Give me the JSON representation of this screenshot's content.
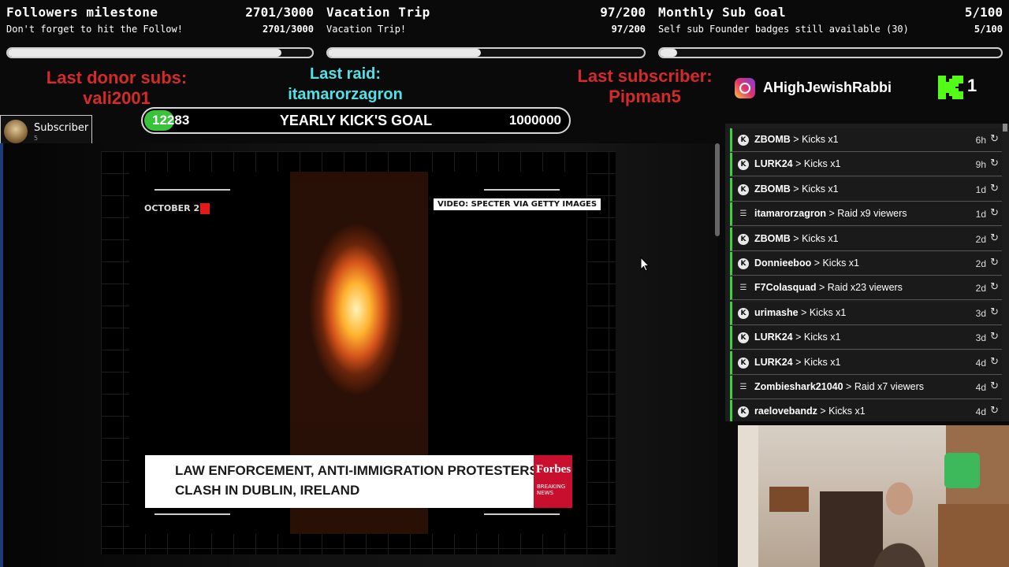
{
  "goals": [
    {
      "title": "Followers milestone",
      "count": "2701/3000",
      "subtitle": "Don't forget to hit the Follow!",
      "count_small": "2701/3000",
      "progress": 0.9
    },
    {
      "title": "Vacation Trip",
      "count": "97/200",
      "subtitle": "Vacation Trip!",
      "count_small": "97/200",
      "progress": 0.485
    },
    {
      "title": "Monthly Sub Goal",
      "count": "5/100",
      "subtitle": "Self sub Founder badges still available (30)",
      "count_small": "5/100",
      "progress": 0.05
    }
  ],
  "last_donor": {
    "label": "Last donor subs:",
    "name": "vali2001"
  },
  "last_raid": {
    "label": "Last raid:",
    "name": "itamarorzagron"
  },
  "last_subscriber": {
    "label": "Last subscriber:",
    "name": "Pipman5"
  },
  "yearly_goal": {
    "current": "12283",
    "label": "YEARLY KICK'S GOAL",
    "target": "1000000"
  },
  "subscriber_badge": {
    "label": "Subscriber",
    "count": "5"
  },
  "instagram": {
    "handle": "AHighJewishRabbi"
  },
  "kick": {
    "count": "1"
  },
  "news": {
    "rec_text": "OCTOBER 2",
    "credit": "VIDEO: SPECTER VIA GETTY IMAGES",
    "headline_1": "LAW ENFORCEMENT, ANTI-IMMIGRATION PROTESTERS",
    "headline_2": "CLASH IN DUBLIN, IRELAND",
    "brand": "Forbes",
    "brand_sub_1": "BREAKING",
    "brand_sub_2": "NEWS"
  },
  "events": [
    {
      "icon": "kick",
      "user": "ZBOMB",
      "action": "Kicks x1",
      "time": "6h"
    },
    {
      "icon": "kick",
      "user": "LURK24",
      "action": "Kicks x1",
      "time": "9h"
    },
    {
      "icon": "kick",
      "user": "ZBOMB",
      "action": "Kicks x1",
      "time": "1d"
    },
    {
      "icon": "raid",
      "user": "itamarorzagron",
      "action": "Raid x9 viewers",
      "time": "1d"
    },
    {
      "icon": "kick",
      "user": "ZBOMB",
      "action": "Kicks x1",
      "time": "2d"
    },
    {
      "icon": "kick",
      "user": "Donnieeboo",
      "action": "Kicks x1",
      "time": "2d"
    },
    {
      "icon": "raid",
      "user": "F7Colasquad",
      "action": "Raid x23 viewers",
      "time": "2d"
    },
    {
      "icon": "kick",
      "user": "urimashe",
      "action": "Kicks x1",
      "time": "3d"
    },
    {
      "icon": "kick",
      "user": "LURK24",
      "action": "Kicks x1",
      "time": "3d"
    },
    {
      "icon": "kick",
      "user": "LURK24",
      "action": "Kicks x1",
      "time": "4d"
    },
    {
      "icon": "raid",
      "user": "Zombieshark21040",
      "action": "Raid x7 viewers",
      "time": "4d"
    },
    {
      "icon": "kick",
      "user": "raelovebandz",
      "action": "Kicks x1",
      "time": "4d"
    }
  ],
  "colors": {
    "accent_green": "#3bd23b",
    "alert_red": "#d42a2a",
    "raid_cyan": "#4fe1e6",
    "forbes_red": "#c8102e"
  }
}
